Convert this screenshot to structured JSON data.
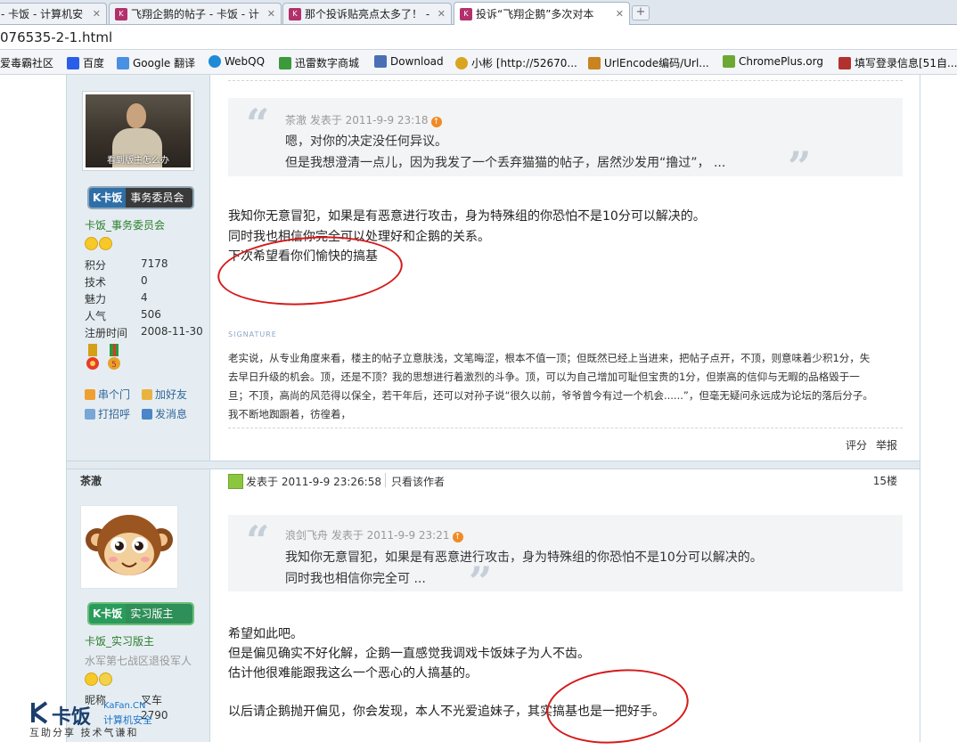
{
  "browser": {
    "tabs": [
      {
        "title": "- 卡饭 - 计算机安",
        "favicon": "kafan-favicon"
      },
      {
        "title": "飞翔企鹅的帖子 - 卡饭 - 计",
        "favicon": "kafan-favicon"
      },
      {
        "title": "那个投诉贴亮点太多了！ -",
        "favicon": "kafan-favicon"
      },
      {
        "title": "投诉“飞翔企鹅”多次对本",
        "favicon": "kafan-favicon"
      }
    ],
    "address": "076535-2-1.html",
    "bookmarks": [
      {
        "label": "爱毒霸社区",
        "color": "#2a6db0"
      },
      {
        "label": "百度",
        "color": "#2b5ee8"
      },
      {
        "label": "Google 翻译",
        "color": "#4a90e2"
      },
      {
        "label": "WebQQ",
        "color": "#1f8ad6"
      },
      {
        "label": "迅雷数字商城",
        "color": "#3b9a3b"
      },
      {
        "label": "Download",
        "color": "#4b6fb5"
      },
      {
        "label": "小彬 [http://52670...",
        "color": "#d9a520"
      },
      {
        "label": "UrlEncode编码/Url...",
        "color": "#c9831f"
      },
      {
        "label": "ChromePlus.org",
        "color": "#6da832"
      },
      {
        "label": "填写登录信息[51自...",
        "color": "#b2312f"
      }
    ]
  },
  "post1": {
    "avatar_caption": "看到版主怎么办",
    "badge": {
      "k": "K卡饭",
      "t": "事务委员会"
    },
    "group": "卡饭_事务委员会",
    "stats": [
      {
        "label": "积分",
        "value": "7178"
      },
      {
        "label": "技术",
        "value": "0"
      },
      {
        "label": "魅力",
        "value": "4"
      },
      {
        "label": "人气",
        "value": "506"
      },
      {
        "label": "注册时间",
        "value": "2008-11-30"
      }
    ],
    "links": {
      "visit": "串个门",
      "add_friend": "加好友",
      "greet": "打招呼",
      "message": "发消息"
    },
    "quote": {
      "header": "茶澈 发表于 2011-9-9 23:18",
      "lines": [
        "嗯，对你的决定没任何异议。",
        "但是我想澄清一点儿，因为我发了一个丢弃猫猫的帖子，居然沙发用“撸过”， ..."
      ]
    },
    "body": [
      "我知你无意冒犯，如果是有恶意进行攻击，身为特殊组的你恐怕不是10分可以解决的。",
      "同时我也相信你完全可以处理好和企鹅的关系。",
      "下次希望看你们愉快的搞基"
    ],
    "signature_title": "SIGNATURE",
    "signature_lines": [
      "老实说，从专业角度来看，楼主的帖子立意肤浅，文笔晦涩，根本不值一顶；但既然已经上当进来，把帖子点开，不顶，则意味着少积1分，失",
      "去早日升级的机会。顶，还是不顶？我的思想进行着激烈的斗争。顶，可以为自己增加可耻但宝贵的1分，但崇高的信仰与无暇的品格毁于一",
      "旦；不顶，高尚的风范得以保全，若干年后，还可以对孙子说“很久以前，爷爷曾今有过一个机会......”，但毫无疑问永远成为论坛的落后分子。",
      "我不断地踟蹰着，彷徨着，"
    ],
    "actions": {
      "rate": "评分",
      "report": "举报"
    }
  },
  "post2": {
    "author": "茶澈",
    "posted": "发表于 2011-9-9 23:26:58",
    "only_author": "只看该作者",
    "floor": "15楼",
    "badge": {
      "k": "K卡饭",
      "t": "实习版主"
    },
    "group": "卡饭_实习版主",
    "title_line": "水军第七战区退役军人",
    "stat_label": "昵称",
    "stat_value": "叉车",
    "stat2_value": "2790",
    "quote": {
      "header": "浪剑飞舟 发表于 2011-9-9 23:21",
      "lines": [
        "我知你无意冒犯，如果是有恶意进行攻击，身为特殊组的你恐怕不是10分可以解决的。",
        "同时我也相信你完全可 ..."
      ]
    },
    "body": [
      "希望如此吧。",
      "但是偏见确实不好化解，企鹅一直感觉我调戏卡饭妹子为人不齿。",
      "估计他很难能跟我这么一个恶心的人搞基的。",
      "以后请企鹅抛开偏见，你会发现，本人不光爱追妹子，其实搞基也是一把好手。"
    ]
  },
  "watermark": {
    "logo": "卡饭",
    "site": "KaFan.CN",
    "cn": "计算机安全",
    "slogan": "互助分享  技术气谦和"
  }
}
